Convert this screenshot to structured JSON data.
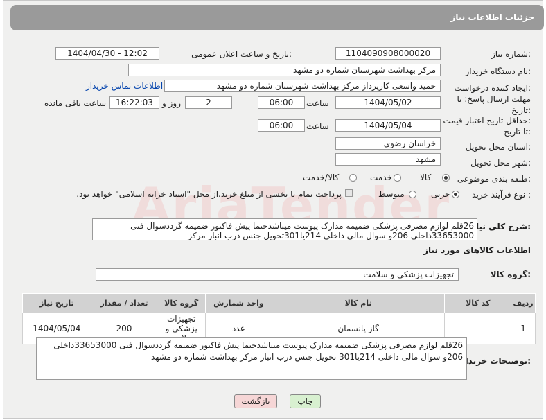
{
  "header": {
    "title": "جزئیات اطلاعات نیاز"
  },
  "form": {
    "need_number_label": "شماره نیاز:",
    "need_number": "1104090908000020",
    "announce_label": "تاریخ و ساعت اعلان عمومی:",
    "announce_value": "1404/04/30 - 12:02",
    "buyer_org_label": "نام دستگاه خریدار:",
    "buyer_org": "مرکز بهداشت شهرستان شماره دو مشهد",
    "creator_label": "ایجاد کننده درخواست:",
    "creator": "حمید واسعی کارپرداز مرکز بهداشت شهرستان شماره دو مشهد",
    "contact_link": "اطلاعات تماس خریدار",
    "reply_deadline_label_1": "مهلت ارسال پاسخ: تا",
    "reply_deadline_label_2": "تاریخ:",
    "reply_date": "1404/05/02",
    "time_label": "ساعت",
    "reply_time": "06:00",
    "days_value": "2",
    "days_label": "روز و",
    "remaining_time": "16:22:03",
    "remaining_label": "ساعت باقی مانده",
    "price_validity_label_1": "حداقل تاریخ اعتبار قیمت:",
    "price_validity_label_2": "تا تاریخ:",
    "validity_date": "1404/05/04",
    "validity_time": "06:00",
    "province_label": "استان محل تحویل:",
    "province": "خراسان رضوی",
    "city_label": "شهر محل تحویل:",
    "city": "مشهد",
    "category_label": "طبقه بندی موضوعی:",
    "category_options": [
      "کالا",
      "خدمت",
      "کالا/خدمت"
    ],
    "process_label": "نوع فرآیند خرید :",
    "process_options": [
      "جزیی",
      "متوسط"
    ],
    "payment_note": "پرداخت تمام یا بخشی از مبلغ خرید،از محل \"اسناد خزانه اسلامی\" خواهد بود.",
    "description_label": "شرح کلی نیاز:",
    "description": "26قلم لوازم مصرفی پزشکی ضمیمه مدارک پیوست میباشدحتما پیش فاکتور ضمیمه گرددسوال فنی 33653000داخلی 206و سوال مالی داخلی 214یا301تحویل جنس درب انبار مرکز"
  },
  "goods": {
    "section_title": "اطلاعات کالاهای مورد نیاز",
    "group_label": "گروه کالا:",
    "group_value": "تجهیزات پزشکی و سلامت",
    "columns": [
      "ردیف",
      "کد کالا",
      "نام کالا",
      "واحد شمارش",
      "گروه کالا",
      "تعداد / مقدار",
      "تاریخ نیاز"
    ],
    "rows": [
      {
        "index": "1",
        "code": "--",
        "name": "گاز پانسمان",
        "unit": "عدد",
        "group": "تجهیزات پزشکی و سلامت",
        "qty": "200",
        "date": "1404/05/04"
      }
    ]
  },
  "buyer_notes": {
    "label": "توضیحات خریدار:",
    "text": "26قلم لوازم مصرفی پزشکی ضمیمه مدارک پیوست میباشدحتما پیش فاکتور ضمیمه گرددسوال فنی 33653000داخلی 206و سوال مالی داخلی 214یا301 تحویل جنس درب انبار مرکز بهداشت شماره دو مشهد"
  },
  "buttons": {
    "print": "چاپ",
    "back": "بازگشت"
  },
  "colors": {
    "header_bg": "#9a9a9a",
    "panel_bg": "#f0f0ef",
    "link": "#0645ad",
    "back_button_bg": "#f6d6d6",
    "print_button_bg": "#d8f0d0"
  }
}
